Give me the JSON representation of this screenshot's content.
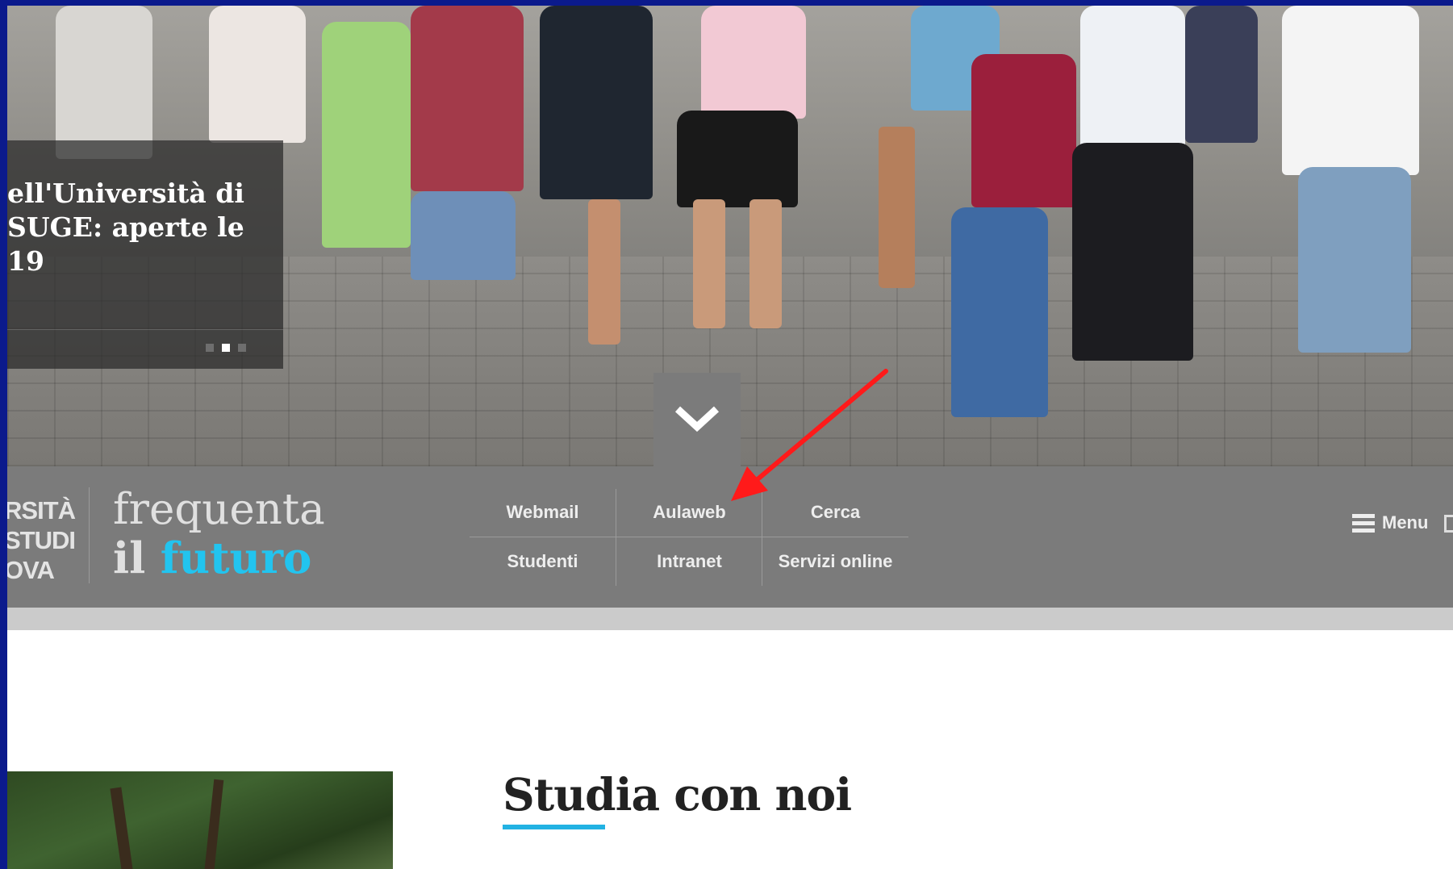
{
  "hero": {
    "caption_lines": [
      "ell'Università di",
      "SUGE: aperte le",
      "19"
    ],
    "slider_dots": 3,
    "active_dot": 2,
    "scroll_down_icon": "chevron-down-icon"
  },
  "header": {
    "university_logo_lines": [
      "RSITÀ",
      "STUDI",
      "OVA"
    ],
    "tagline_line1": "frequenta",
    "tagline_il": "il",
    "tagline_futuro": "futuro",
    "quick_links": {
      "webmail": "Webmail",
      "aulaweb": "Aulaweb",
      "cerca": "Cerca",
      "studenti": "Studenti",
      "intranet": "Intranet",
      "servizi_online": "Servizi online"
    },
    "menu_label": "Menu",
    "menu_icon": "hamburger-icon"
  },
  "content": {
    "section_title": "Studia con noi"
  },
  "colors": {
    "header_bg": "#7b7b7b",
    "accent": "#22c4ef",
    "annotation": "#ff1a1a",
    "frame": "#0b1a8c"
  }
}
